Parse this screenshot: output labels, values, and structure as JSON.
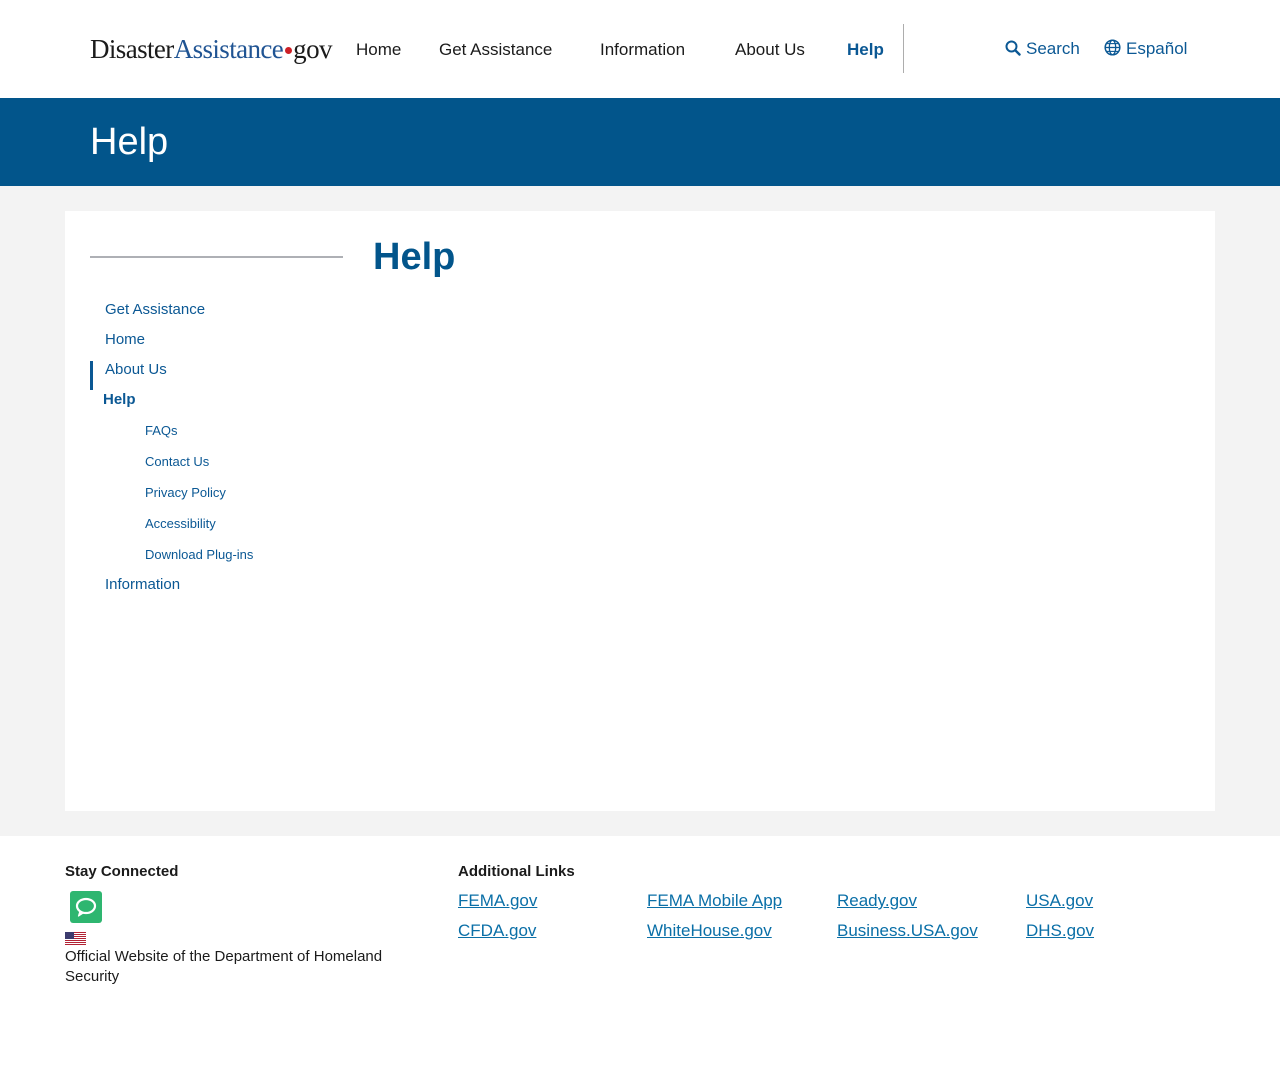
{
  "header": {
    "logo": {
      "part1": "Disaster",
      "part2": "Assistance",
      "part3": "gov"
    },
    "nav": [
      {
        "label": "Home",
        "active": false
      },
      {
        "label": "Get Assistance",
        "active": false
      },
      {
        "label": "Information",
        "active": false
      },
      {
        "label": "About Us",
        "active": false
      },
      {
        "label": "Help",
        "active": true
      }
    ],
    "search_label": "Search",
    "language_label": "Español"
  },
  "banner": {
    "title": "Help"
  },
  "sidebar": {
    "items": [
      {
        "label": "Get Assistance"
      },
      {
        "label": "Home"
      },
      {
        "label": "About Us"
      },
      {
        "label": "Help",
        "active": true
      },
      {
        "label": "Information"
      }
    ],
    "sub_items": [
      {
        "label": "FAQs"
      },
      {
        "label": "Contact Us"
      },
      {
        "label": "Privacy Policy"
      },
      {
        "label": "Accessibility"
      },
      {
        "label": "Download Plug-ins"
      }
    ]
  },
  "main": {
    "title": "Help"
  },
  "footer": {
    "stay_connected": "Stay Connected",
    "official_text": "Official Website of the Department of Homeland Security",
    "additional_links_heading": "Additional Links",
    "links": [
      {
        "label": "FEMA.gov"
      },
      {
        "label": "FEMA Mobile App"
      },
      {
        "label": "Ready.gov"
      },
      {
        "label": "USA.gov"
      },
      {
        "label": "CFDA.gov"
      },
      {
        "label": "WhiteHouse.gov"
      },
      {
        "label": "Business.USA.gov"
      },
      {
        "label": "DHS.gov"
      }
    ]
  },
  "colors": {
    "primary_blue": "#02558b",
    "link_blue": "#0b5894",
    "footer_link": "#0a6fa7",
    "background_gray": "#f3f3f3",
    "logo_dot_red": "#cd2026",
    "chat_green": "#2eb670"
  }
}
